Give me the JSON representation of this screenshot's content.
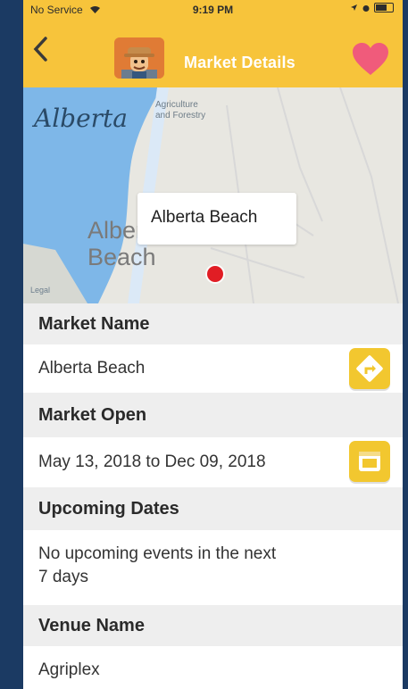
{
  "status_bar": {
    "carrier": "No Service",
    "time": "9:19 PM"
  },
  "nav": {
    "back_icon": "chevron-left-icon",
    "title": "Market Details",
    "favorite_icon": "heart-icon",
    "favorite_color": "#f05b7b"
  },
  "map": {
    "brand": "Alberta",
    "brand_sub_line1": "Agriculture",
    "brand_sub_line2": "and Forestry",
    "place_line1": "Alberta",
    "place_line2": "Beach",
    "callout": "Alberta Beach",
    "legal": "Legal"
  },
  "details": {
    "market_name_label": "Market Name",
    "market_name": "Alberta Beach",
    "market_open_label": "Market Open",
    "market_open": "May 13, 2018 to Dec 09, 2018",
    "upcoming_label": "Upcoming Dates",
    "upcoming_line1": "No upcoming events in the next",
    "upcoming_line2": "7 days",
    "venue_label": "Venue Name",
    "venue": "Agriplex"
  },
  "colors": {
    "nav_bar": "#f7c43b",
    "background": "#1b3a63",
    "button": "#f2c72f"
  }
}
